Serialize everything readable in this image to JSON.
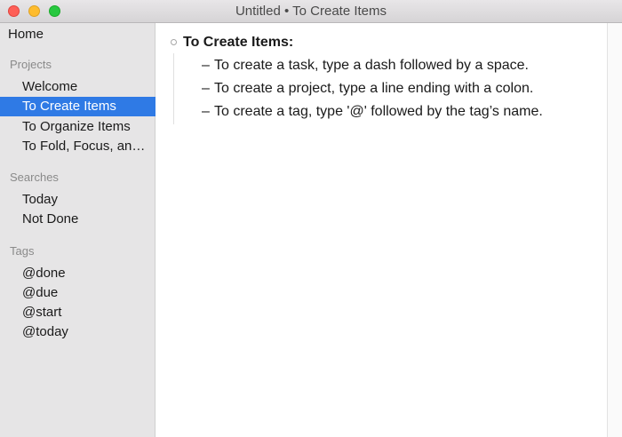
{
  "window": {
    "title": "Untitled • To Create Items"
  },
  "sidebar": {
    "home": "Home",
    "projects_header": "Projects",
    "projects": [
      {
        "label": "Welcome"
      },
      {
        "label": "To Create Items",
        "selected": true
      },
      {
        "label": "To Organize Items"
      },
      {
        "label": "To Fold, Focus, and Filter"
      }
    ],
    "searches_header": "Searches",
    "searches": [
      {
        "label": "Today"
      },
      {
        "label": "Not Done"
      }
    ],
    "tags_header": "Tags",
    "tags": [
      {
        "label": "@done"
      },
      {
        "label": "@due"
      },
      {
        "label": "@start"
      },
      {
        "label": "@today"
      }
    ]
  },
  "editor": {
    "project_title": "To Create Items:",
    "task_marker": "–",
    "tasks": [
      {
        "text": "To create a task, type a dash followed by a space."
      },
      {
        "text": "To create a project, type a line ending with a colon."
      },
      {
        "text": "To create a tag, type '@' followed by the tag’s name."
      }
    ]
  },
  "colors": {
    "selection": "#2f7ae5",
    "sidebar_bg": "#e6e5e6",
    "close": "#fe5f57",
    "minimize": "#febc2e",
    "maximize": "#28c840"
  }
}
